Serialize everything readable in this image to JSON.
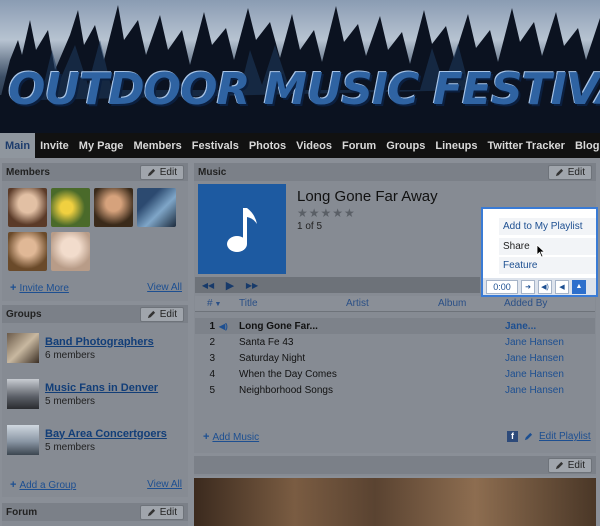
{
  "banner": {
    "title": "OUTDOOR MUSIC FESTIVALS"
  },
  "nav": {
    "tabs": [
      "Main",
      "Invite",
      "My Page",
      "Members",
      "Festivals",
      "Photos",
      "Videos",
      "Forum",
      "Groups",
      "Lineups",
      "Twitter Tracker",
      "Blog"
    ]
  },
  "members": {
    "title": "Members",
    "edit_label": "Edit",
    "invite_label": "Invite More",
    "view_all_label": "View All",
    "thumbs": [
      "#b98c6c",
      "#d7b62c",
      "#8a6a4a",
      "#2f4e70",
      "#c0a07a",
      "#d8c6b6"
    ]
  },
  "groups": {
    "title": "Groups",
    "edit_label": "Edit",
    "items": [
      {
        "name": "Band Photographers",
        "count": "6 members"
      },
      {
        "name": "Music Fans in Denver",
        "count": "5 members"
      },
      {
        "name": "Bay Area Concertgoers",
        "count": "5 members"
      }
    ],
    "add_label": "Add a Group",
    "view_all_label": "View All"
  },
  "forum": {
    "title": "Forum",
    "edit_label": "Edit"
  },
  "music": {
    "title": "Music",
    "edit_label": "Edit",
    "song_title": "Long Gone Far Away",
    "stars": "★★★★★",
    "count": "1 of 5",
    "columns": {
      "num": "#",
      "title": "Title",
      "artist": "Artist",
      "album": "Album",
      "added_by": "Added By"
    },
    "tracks": [
      {
        "num": "1",
        "title": "Long Gone Far...",
        "added_by": "Jane..."
      },
      {
        "num": "2",
        "title": "Santa Fe 43",
        "added_by": "Jane Hansen"
      },
      {
        "num": "3",
        "title": "Saturday Night",
        "added_by": "Jane Hansen"
      },
      {
        "num": "4",
        "title": "When the Day Comes",
        "added_by": "Jane Hansen"
      },
      {
        "num": "5",
        "title": "Neighborhood Songs",
        "added_by": "Jane Hansen"
      }
    ],
    "add_label": "Add Music",
    "edit_playlist_label": "Edit Playlist"
  },
  "popup": {
    "items": [
      "Add to My Playlist",
      "Share",
      "Feature"
    ],
    "time": "0:00"
  },
  "photo_panel": {
    "edit_label": "Edit"
  },
  "colors": {
    "accent": "#3a7bd5",
    "link": "#1d4f91",
    "album": "#1d5aa1"
  }
}
